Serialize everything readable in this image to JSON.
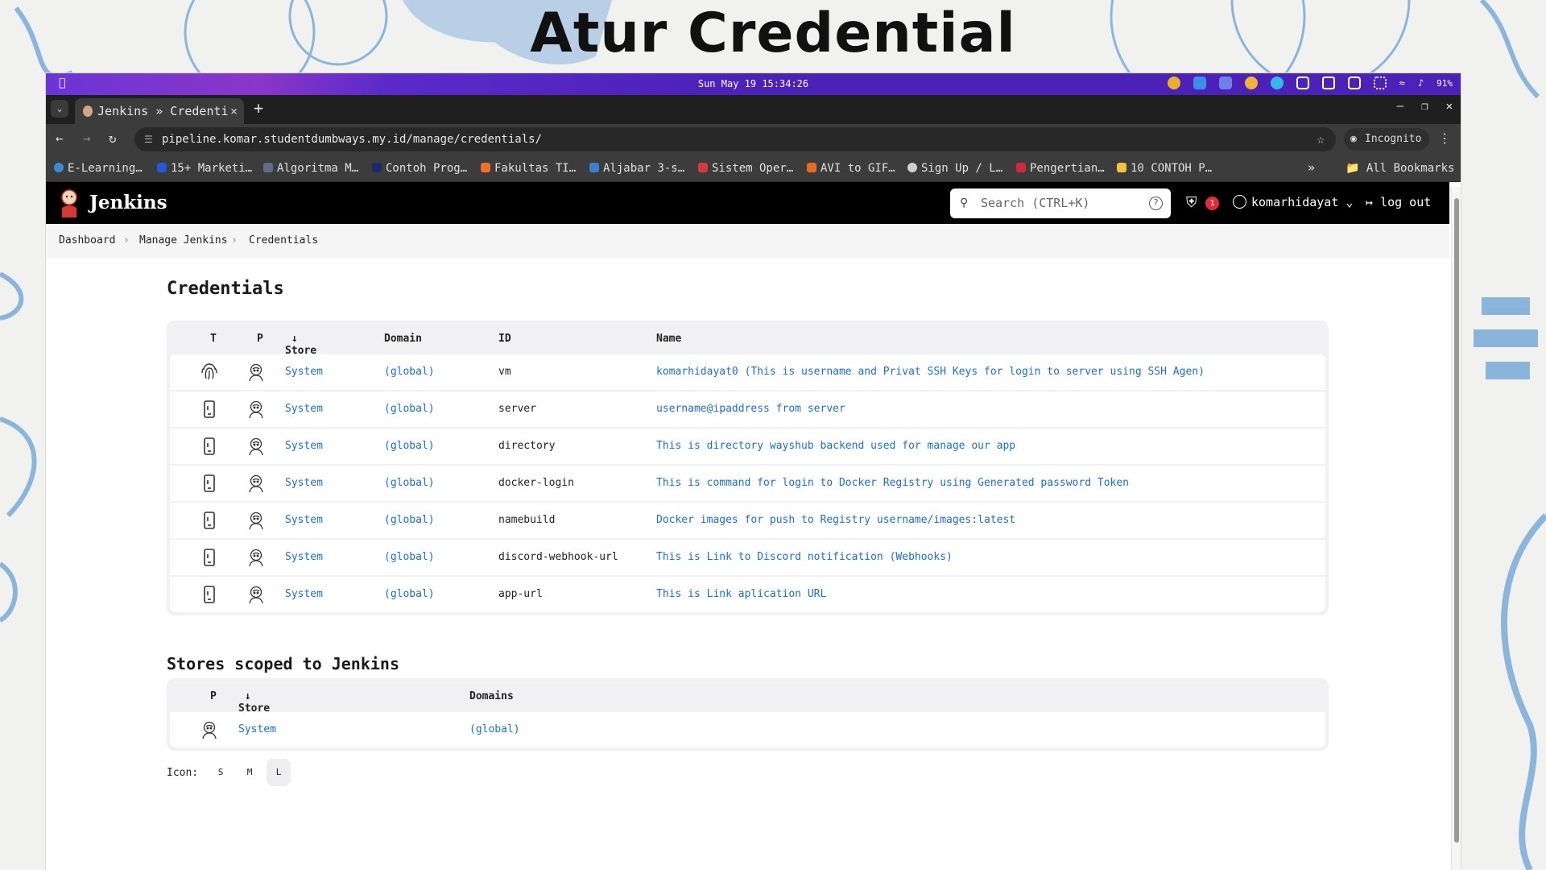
{
  "slide": {
    "title": "Atur Credential"
  },
  "menubar": {
    "clock": "Sun May 19 15:34:26",
    "battery": "91%"
  },
  "browser": {
    "tab_title": "Jenkins » Credenti",
    "url": "pipeline.komar.studentdumbways.my.id/manage/credentials/",
    "incognito_label": "Incognito",
    "bookmarks": [
      "E-Learning…",
      "15+ Marketi…",
      "Algoritma M…",
      "Contoh Prog…",
      "Fakultas TI…",
      "Aljabar 3-s…",
      "Sistem Oper…",
      "AVI to GIF…",
      "Sign Up / L…",
      "Pengertian…",
      "10 CONTOH P…"
    ],
    "all_bookmarks_label": "All Bookmarks"
  },
  "jenkins": {
    "brand": "Jenkins",
    "search_placeholder": "Search (CTRL+K)",
    "security_badge_count": "1",
    "username": "komarhidayat",
    "logout_label": "log out"
  },
  "breadcrumb": [
    "Dashboard",
    "Manage Jenkins",
    "Credentials"
  ],
  "credentials": {
    "heading": "Credentials",
    "columns": {
      "t": "T",
      "p": "P",
      "store": "Store",
      "domain": "Domain",
      "id": "ID",
      "name": "Name"
    },
    "sort_indicator": "↓",
    "rows": [
      {
        "type_icon": "fingerprint-icon",
        "store": "System",
        "domain": "(global)",
        "id": "vm",
        "name": "komarhidayat0 (This is username and Privat SSH Keys for login to server using SSH Agen)"
      },
      {
        "type_icon": "mobile-text-icon",
        "store": "System",
        "domain": "(global)",
        "id": "server",
        "name": "username@ipaddress from server"
      },
      {
        "type_icon": "mobile-text-icon",
        "store": "System",
        "domain": "(global)",
        "id": "directory",
        "name": "This is directory wayshub backend used for manage our app"
      },
      {
        "type_icon": "mobile-text-icon",
        "store": "System",
        "domain": "(global)",
        "id": "docker-login",
        "name": "This is command for login to Docker Registry using Generated password Token"
      },
      {
        "type_icon": "mobile-text-icon",
        "store": "System",
        "domain": "(global)",
        "id": "namebuild",
        "name": "Docker images for push to Registry username/images:latest"
      },
      {
        "type_icon": "mobile-text-icon",
        "store": "System",
        "domain": "(global)",
        "id": "discord-webhook-url",
        "name": "This is Link to Discord notification (Webhooks)"
      },
      {
        "type_icon": "mobile-text-icon",
        "store": "System",
        "domain": "(global)",
        "id": "app-url",
        "name": "This is Link aplication URL"
      }
    ]
  },
  "stores": {
    "heading": "Stores scoped to Jenkins",
    "columns": {
      "p": "P",
      "store": "Store",
      "domains": "Domains"
    },
    "rows": [
      {
        "store": "System",
        "domains": "(global)"
      }
    ]
  },
  "icon_size": {
    "label": "Icon:",
    "options": [
      "S",
      "M",
      "L"
    ],
    "selected": "L"
  },
  "colors": {
    "link": "#1c6ed3",
    "header_bg": "#000000",
    "badge": "#e02d3c",
    "menubar": "#4b21b8"
  }
}
